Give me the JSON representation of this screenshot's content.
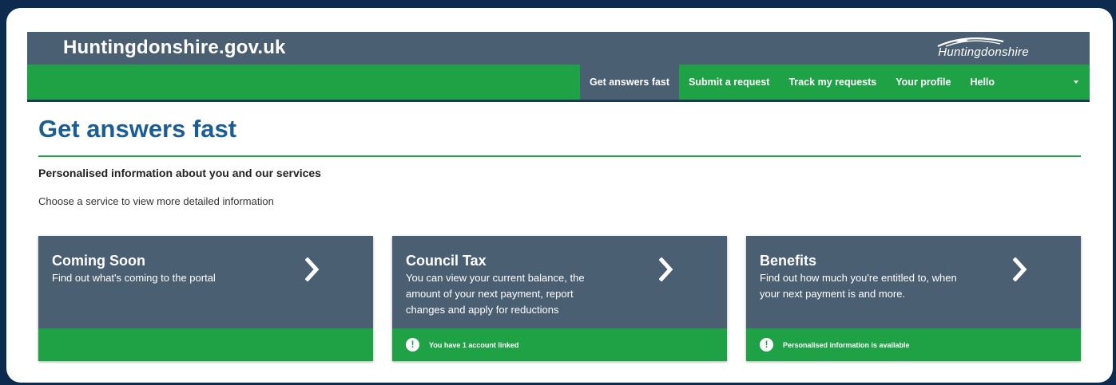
{
  "header": {
    "site_title": "Huntingdonshire.gov.uk",
    "logo_text": "Huntingdonshire"
  },
  "nav": {
    "items": [
      {
        "label": "Get answers fast",
        "active": true
      },
      {
        "label": "Submit a request",
        "active": false
      },
      {
        "label": "Track my requests",
        "active": false
      },
      {
        "label": "Your profile",
        "active": false
      },
      {
        "label": "Hello",
        "active": false
      }
    ]
  },
  "main": {
    "title": "Get answers fast",
    "subheading": "Personalised information about you and our services",
    "intro": "Choose a service to view more detailed information"
  },
  "cards": [
    {
      "title": "Coming Soon",
      "description": "Find out what's coming to the portal",
      "footer_text": ""
    },
    {
      "title": "Council Tax",
      "description": "You can view your current balance, the amount of your next payment, report changes and apply for reductions",
      "footer_text": "You have 1 account linked"
    },
    {
      "title": "Benefits",
      "description": "Find out how much you're entitled to, when your next payment is and more.",
      "footer_text": "Personalised information is available"
    }
  ],
  "colors": {
    "background": "#0d2b4e",
    "header": "#4b5f73",
    "accent_green": "#1fa245",
    "title_blue": "#1a5e94"
  },
  "icons": {
    "card_arrow": "chevron-right-icon",
    "footer_alert": "exclamation-circle-icon",
    "nav_dropdown": "caret-down-icon"
  }
}
